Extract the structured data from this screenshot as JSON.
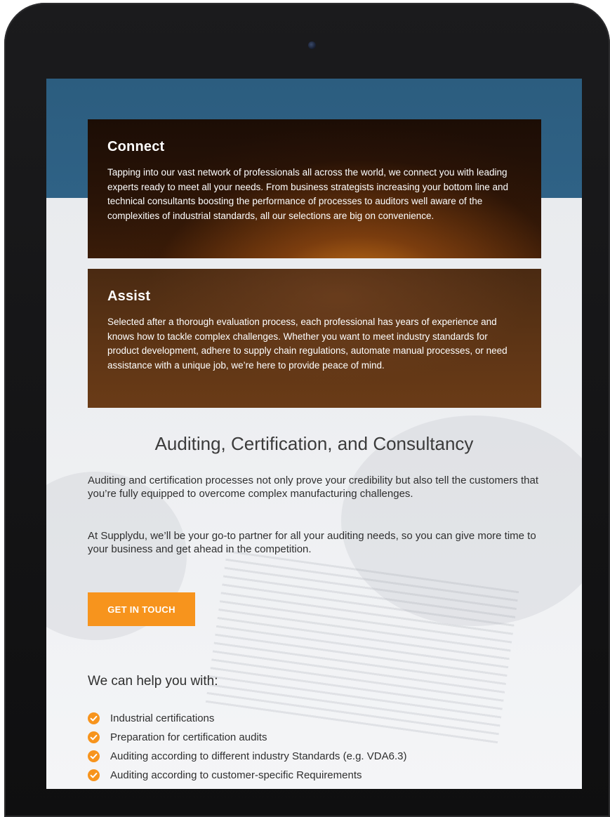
{
  "cards": [
    {
      "title": "Connect",
      "text": "Tapping into our vast network of professionals all across the world, we connect you with leading experts ready to meet all your needs. From business strategists increasing your bottom line and technical consultants boosting the performance of processes to auditors well aware of the complexities of industrial standards, all our selections are big on convenience."
    },
    {
      "title": "Assist",
      "text": "Selected after a thorough evaluation process, each professional has years of experience and knows how to tackle complex challenges. Whether you want to meet industry standards for product development, adhere to supply chain regulations, automate manual processes, or need assistance with a unique job, we’re here to provide peace of mind."
    }
  ],
  "section": {
    "title": "Auditing, Certification, and Consultancy",
    "paragraphs": [
      "Auditing and certification processes not only prove your credibility but also tell the customers that you’re fully equipped to overcome complex manufacturing challenges.",
      "At Supplydu, we’ll be your go-to partner for all your auditing needs, so you can give more time to your business and get ahead in the competition."
    ],
    "cta_label": "GET IN TOUCH"
  },
  "help": {
    "heading": "We can help you with:",
    "items": [
      "Industrial certifications",
      "Preparation for certification audits",
      "Auditing according to different industry Standards (e.g. VDA6.3)",
      "Auditing according to customer-specific Requirements"
    ],
    "icon": "check-circle-icon"
  },
  "colors": {
    "accent": "#f7941d",
    "header_blue": "#2c5d7f",
    "device_frame": "#151516"
  }
}
